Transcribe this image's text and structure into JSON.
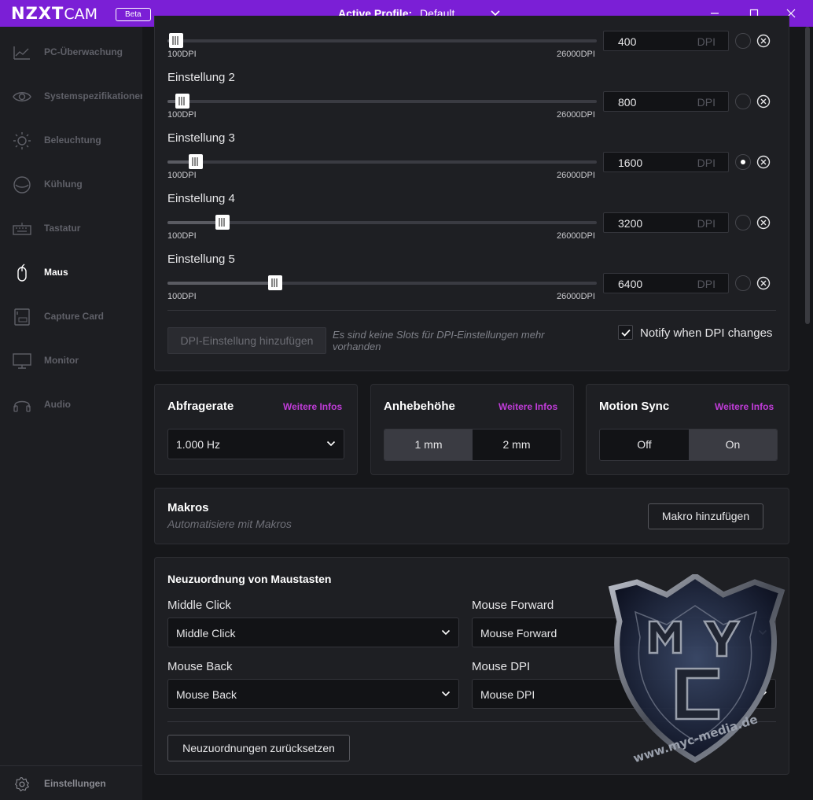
{
  "titlebar": {
    "brand": "NZXT",
    "product": "CAM",
    "badge": "Beta",
    "profile_label": "Active Profile:",
    "profile_value": "Default"
  },
  "sidebar": {
    "items": [
      {
        "label": "PC-Überwachung",
        "icon": "chart-line-icon"
      },
      {
        "label": "Systemspezifikationen",
        "icon": "eye-icon"
      },
      {
        "label": "Beleuchtung",
        "icon": "sun-icon"
      },
      {
        "label": "Kühlung",
        "icon": "fan-icon"
      },
      {
        "label": "Tastatur",
        "icon": "keyboard-icon"
      },
      {
        "label": "Maus",
        "icon": "mouse-icon",
        "active": true
      },
      {
        "label": "Capture Card",
        "icon": "capture-card-icon"
      },
      {
        "label": "Monitor",
        "icon": "monitor-icon"
      },
      {
        "label": "Audio",
        "icon": "headset-icon"
      }
    ],
    "settings_label": "Einstellungen"
  },
  "dpi": {
    "min_label": "100DPI",
    "max_label": "26000DPI",
    "unit": "DPI",
    "slots": [
      {
        "title": "",
        "value": "400",
        "level": 0.012,
        "selected": false
      },
      {
        "title": "Einstellung 2",
        "value": "800",
        "level": 0.027,
        "selected": false
      },
      {
        "title": "Einstellung 3",
        "value": "1600",
        "level": 0.058,
        "selected": true
      },
      {
        "title": "Einstellung 4",
        "value": "3200",
        "level": 0.12,
        "selected": false
      },
      {
        "title": "Einstellung 5",
        "value": "6400",
        "level": 0.243,
        "selected": false
      }
    ],
    "add_button": "DPI-Einstellung hinzufügen",
    "no_slots_note": "Es sind keine Slots für DPI-Einstellungen mehr vorhanden",
    "notify_label": "Notify when DPI changes",
    "notify_checked": true
  },
  "polling": {
    "title": "Abfragerate",
    "more_info": "Weitere Infos",
    "value": "1.000 Hz"
  },
  "lift": {
    "title": "Anhebehöhe",
    "more_info": "Weitere Infos",
    "options": [
      "1 mm",
      "2 mm"
    ],
    "active": "1 mm"
  },
  "motion_sync": {
    "title": "Motion Sync",
    "more_info": "Weitere Infos",
    "options": [
      "Off",
      "On"
    ],
    "active": "On"
  },
  "macros": {
    "title": "Makros",
    "subtitle": "Automatisiere mit Makros",
    "add_button": "Makro hinzufügen"
  },
  "remap": {
    "title": "Neuzuordnung von Maustasten",
    "fields": [
      {
        "label": "Middle Click",
        "value": "Middle Click"
      },
      {
        "label": "Mouse Forward",
        "value": "Mouse Forward"
      },
      {
        "label": "Mouse Back",
        "value": "Mouse Back"
      },
      {
        "label": "Mouse DPI",
        "value": "Mouse DPI"
      }
    ],
    "reset_button": "Neuzuordnungen zurücksetzen"
  },
  "watermark": {
    "text": "www.myc-media.de"
  },
  "colors": {
    "titlebar": "#7b1fd6",
    "accent_link": "#c03cd8",
    "background": "#16171a",
    "card": "#1e1f23"
  }
}
